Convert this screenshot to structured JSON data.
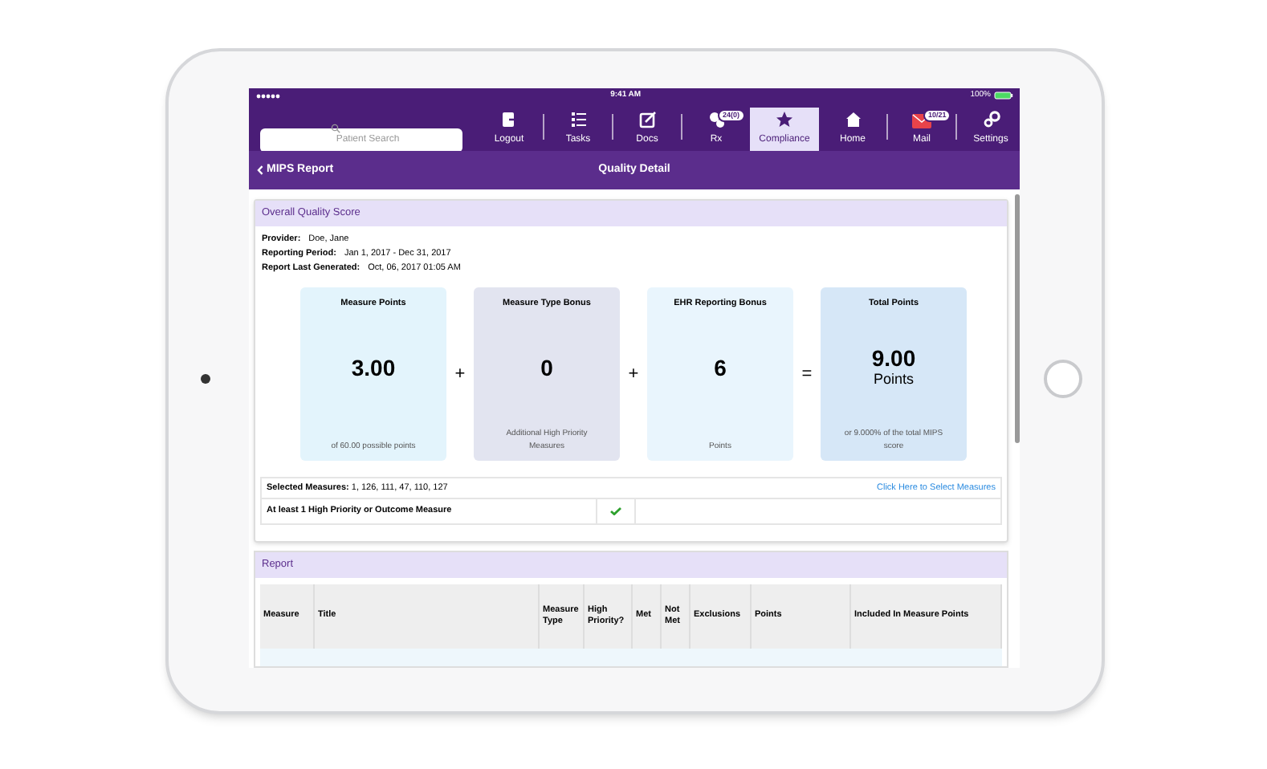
{
  "status_bar": {
    "time": "9:41 AM",
    "battery": "100%"
  },
  "search": {
    "placeholder": "Patient Search"
  },
  "nav": [
    {
      "label": "Logout",
      "selected": false
    },
    {
      "label": "Tasks",
      "selected": false
    },
    {
      "label": "Docs",
      "selected": false
    },
    {
      "label": "Rx",
      "selected": false,
      "badge": "24(0)"
    },
    {
      "label": "Compliance",
      "selected": true
    },
    {
      "label": "Home",
      "selected": false
    },
    {
      "label": "Mail",
      "selected": false,
      "badge": "10/21"
    },
    {
      "label": "Settings",
      "selected": false
    }
  ],
  "subheader": {
    "back": "MIPS Report",
    "title": "Quality Detail"
  },
  "overall": {
    "title": "Overall Quality Score",
    "info": [
      {
        "label": "Provider:",
        "value": "Doe, Jane"
      },
      {
        "label": "Reporting Period:",
        "value": "Jan 1, 2017 - Dec 31, 2017"
      },
      {
        "label": "Report Last Generated:",
        "value": "Oct, 06, 2017 01:05 AM"
      }
    ],
    "cards": [
      {
        "title": "Measure Points",
        "value": "3.00",
        "caption": "of 60.00 possible points",
        "color": "#e3f4fc",
        "operator": "+"
      },
      {
        "title": "Measure Type Bonus",
        "value": "0",
        "caption": "Additional High Priority Measures",
        "color": "#e2e4f0",
        "operator": "+"
      },
      {
        "title": "EHR Reporting Bonus",
        "value": "6",
        "caption": "Points",
        "color": "#e9f5fd",
        "operator": "="
      },
      {
        "title": "Total Points",
        "value": "9.00",
        "unit": "Points",
        "caption": "or 9.000% of the total MIPS score",
        "color": "#d6e7f7"
      }
    ],
    "selected_measures": {
      "label": "Selected Measures:",
      "value": "1, 126, 111, 47, 110, 127",
      "link": "Click Here to Select Measures"
    },
    "criteria": [
      {
        "label": "At least 1 High Priority or Outcome Measure",
        "met": true
      }
    ]
  },
  "report": {
    "title": "Report",
    "columns": [
      "Measure",
      "Title",
      "Measure Type",
      "High Priority?",
      "Met",
      "Not Met",
      "Exclusions",
      "Points",
      "Included In Measure Points"
    ]
  }
}
